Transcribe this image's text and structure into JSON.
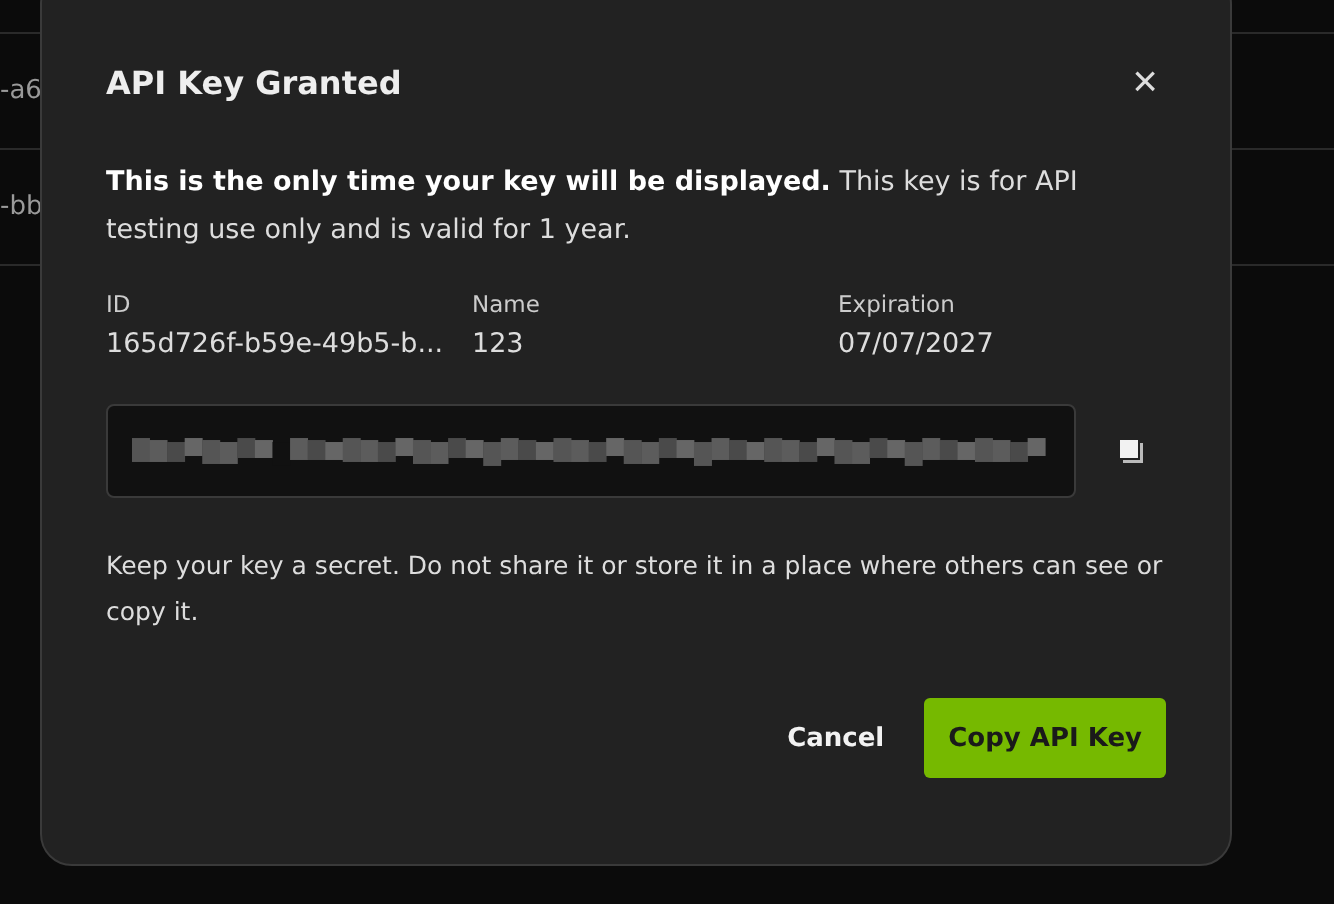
{
  "background_table": {
    "rows": [
      {
        "column_1": "-a6"
      },
      {
        "column_1": "-bb"
      }
    ]
  },
  "dialog": {
    "title": "API Key Granted",
    "close_label": "×",
    "message": "**This is the only time your key will be displayed.** This key is for API testing use only and is valid for 1 year.",
    "details": [
      {
        "label": "ID",
        "value": "165d726f-b59e-49b5-b..."
      },
      {
        "label": "Name",
        "value": "123"
      },
      {
        "label": "Expiration",
        "value": "07/07/2027"
      }
    ],
    "note": "Keep your key a secret. Do not share it or store it in a place where others can see or copy it.",
    "buttons": [
      {
        "label": "Cancel",
        "kind": "secondary"
      },
      {
        "label": "Copy API Key",
        "kind": "primary"
      }
    ]
  }
}
